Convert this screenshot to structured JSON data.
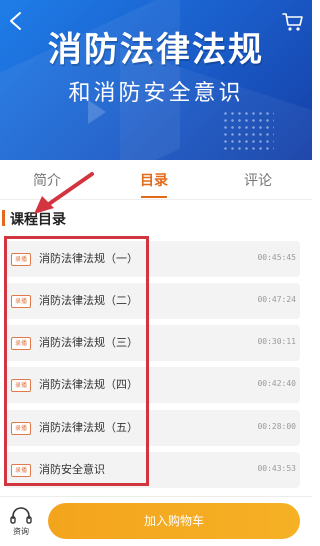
{
  "banner": {
    "title": "消防法律法规",
    "subtitle": "和消防安全意识"
  },
  "tabs": [
    {
      "label": "简介",
      "active": false
    },
    {
      "label": "目录",
      "active": true
    },
    {
      "label": "评论",
      "active": false
    }
  ],
  "section": {
    "title": "课程目录"
  },
  "lessons": [
    {
      "tag": "录播",
      "name": "消防法律法规（一）",
      "duration": "00:45:45"
    },
    {
      "tag": "录播",
      "name": "消防法律法规（二）",
      "duration": "00:47:24"
    },
    {
      "tag": "录播",
      "name": "消防法律法规（三）",
      "duration": "00:30:11"
    },
    {
      "tag": "录播",
      "name": "消防法律法规（四）",
      "duration": "00:42:40"
    },
    {
      "tag": "录播",
      "name": "消防法律法规（五）",
      "duration": "00:28:00"
    },
    {
      "tag": "录播",
      "name": "消防安全意识",
      "duration": "00:43:53"
    }
  ],
  "bottom": {
    "consult_label": "资询",
    "add_to_cart_label": "加入购物车"
  },
  "colors": {
    "accent": "#e36a1b",
    "banner_blue": "#1a5cc9",
    "button": "#f3a41d",
    "annotation_red": "#d2353f"
  },
  "icons": [
    "back-icon",
    "cart-icon",
    "headset-icon",
    "play-icon"
  ]
}
